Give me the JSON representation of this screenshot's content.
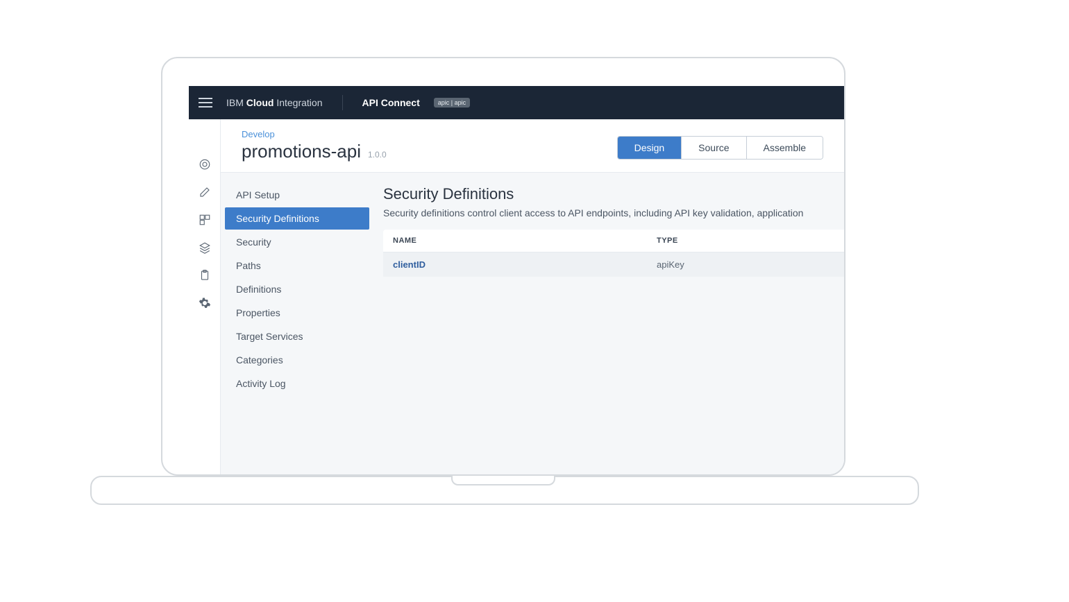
{
  "header": {
    "brand_prefix": "IBM",
    "brand_bold": "Cloud",
    "brand_suffix": "Integration",
    "product": "API Connect",
    "badge": "apic | apic"
  },
  "page": {
    "breadcrumb": "Develop",
    "title": "promotions-api",
    "version": "1.0.0"
  },
  "tabs": {
    "design": "Design",
    "source": "Source",
    "assemble": "Assemble"
  },
  "sidenav": {
    "items": [
      "API Setup",
      "Security Definitions",
      "Security",
      "Paths",
      "Definitions",
      "Properties",
      "Target Services",
      "Categories",
      "Activity Log"
    ]
  },
  "panel": {
    "heading": "Security Definitions",
    "description": "Security definitions control client access to API endpoints, including API key validation, application"
  },
  "table": {
    "columns": {
      "name": "NAME",
      "type": "TYPE"
    },
    "rows": [
      {
        "name": "clientID",
        "type": "apiKey"
      }
    ]
  }
}
